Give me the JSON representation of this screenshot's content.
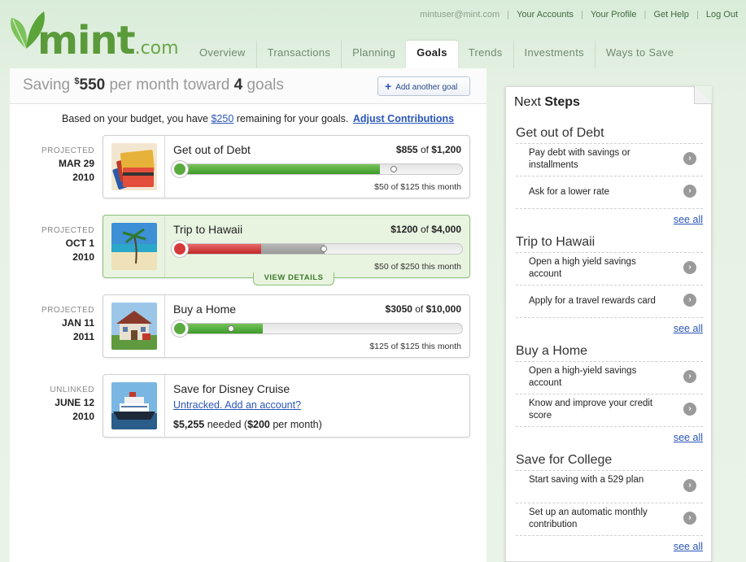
{
  "header": {
    "logo_text": "mint",
    "logo_suffix": ".com",
    "email": "mintuser@mint.com",
    "links": [
      "Your Accounts",
      "Your Profile",
      "Get Help",
      "Log Out"
    ]
  },
  "tabs": [
    "Overview",
    "Transactions",
    "Planning",
    "Goals",
    "Trends",
    "Investments",
    "Ways to Save"
  ],
  "active_tab": "Goals",
  "summary": {
    "prefix": "Saving ",
    "currency": "$",
    "amount": "550",
    "middle": " per month toward ",
    "count": "4",
    "suffix": " goals",
    "add_goal_label": "Add another goal"
  },
  "budget": {
    "text_before": "Based on your budget, you have ",
    "remaining": "$250",
    "text_after": " remaining for your goals.",
    "adjust_label": "Adjust Contributions"
  },
  "goals": [
    {
      "status": "PROJECTED",
      "date": "MAR 29",
      "year": "2010",
      "title": "Get out of Debt",
      "saved": "$855",
      "of_label": " of ",
      "target": "$1,200",
      "monthly": "$50",
      "monthly_of": " of ",
      "monthly_target": "$125",
      "monthly_suffix": " this month",
      "progress": 0.71,
      "month_progress": 0.4,
      "color": "#5aab3f"
    },
    {
      "status": "PROJECTED",
      "date": "OCT 1",
      "year": "2010",
      "title": "Trip to Hawaii",
      "saved": "$1200",
      "of_label": " of ",
      "target": "$4,000",
      "monthly": "$50",
      "monthly_of": " of ",
      "monthly_target": "$250",
      "monthly_suffix": " this month",
      "progress": 0.3,
      "month_progress": 0.2,
      "color": "#d43a3a",
      "view_details_label": "VIEW DETAILS"
    },
    {
      "status": "PROJECTED",
      "date": "JAN 11",
      "year": "2011",
      "title": "Buy a Home",
      "saved": "$3050",
      "of_label": " of ",
      "target": "$10,000",
      "monthly": "$125",
      "monthly_of": " of ",
      "monthly_target": "$125",
      "monthly_suffix": " this month",
      "progress": 0.305,
      "month_progress": 1.0,
      "color": "#5aab3f"
    },
    {
      "status": "UNLINKED",
      "date": "JUNE 12",
      "year": "2010",
      "title": "Save for Disney Cruise",
      "untracked_label": "Untracked. Add an account?",
      "needed_amount": "$5,255",
      "needed_text": " needed (",
      "per_month_amount": "$200",
      "per_month_text": " per month)"
    }
  ],
  "next_steps": {
    "title_prefix": "Next ",
    "title_bold": "Steps",
    "see_all_label": "see all",
    "sections": [
      {
        "title": "Get out of Debt",
        "steps": [
          "Pay debt with savings or installments",
          "Ask for a lower rate"
        ]
      },
      {
        "title": "Trip to Hawaii",
        "steps": [
          "Open a high yield savings account",
          "Apply for a travel rewards card"
        ]
      },
      {
        "title": "Buy a Home",
        "steps": [
          "Open a high-yield savings account",
          "Know and improve your credit score"
        ]
      },
      {
        "title": "Save for College",
        "steps": [
          "Start saving with a 529 plan",
          "Set up an automatic monthly contribution"
        ]
      }
    ]
  }
}
